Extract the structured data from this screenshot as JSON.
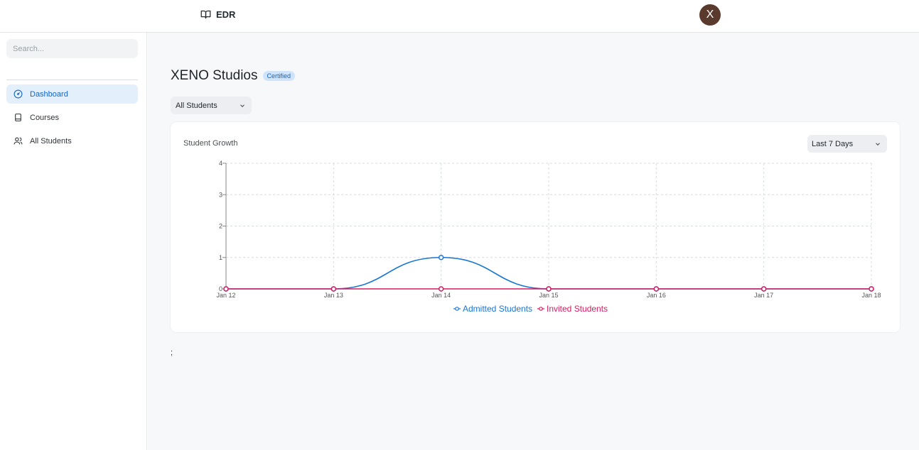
{
  "header": {
    "brand": "EDR",
    "avatar_letter": "X",
    "avatar_color": "#5b3a2e"
  },
  "sidebar": {
    "search_placeholder": "Search...",
    "items": [
      {
        "label": "Dashboard",
        "icon": "dashboard-icon",
        "active": true
      },
      {
        "label": "Courses",
        "icon": "book-icon",
        "active": false
      },
      {
        "label": "All Students",
        "icon": "users-icon",
        "active": false
      }
    ]
  },
  "main": {
    "title": "XENO Studios",
    "badge": "Certified",
    "filter_value": "All Students",
    "footnote": ";"
  },
  "card": {
    "title": "Student Growth",
    "range_value": "Last 7 Days"
  },
  "colors": {
    "accent": "#1565c0",
    "admitted": "#1976d2",
    "invited": "#d81b60"
  },
  "chart_data": {
    "type": "line",
    "categories": [
      "Jan 12",
      "Jan 13",
      "Jan 14",
      "Jan 15",
      "Jan 16",
      "Jan 17",
      "Jan 18"
    ],
    "series": [
      {
        "name": "Admitted Students",
        "values": [
          0,
          0,
          1,
          0,
          0,
          0,
          0
        ],
        "color": "#1976d2"
      },
      {
        "name": "Invited Students",
        "values": [
          0,
          0,
          0,
          0,
          0,
          0,
          0
        ],
        "color": "#d81b60"
      }
    ],
    "yticks": [
      0,
      1,
      2,
      3,
      4
    ],
    "ylim": [
      0,
      4
    ],
    "grid": true,
    "legend": "bottom-center",
    "smooth": true
  }
}
